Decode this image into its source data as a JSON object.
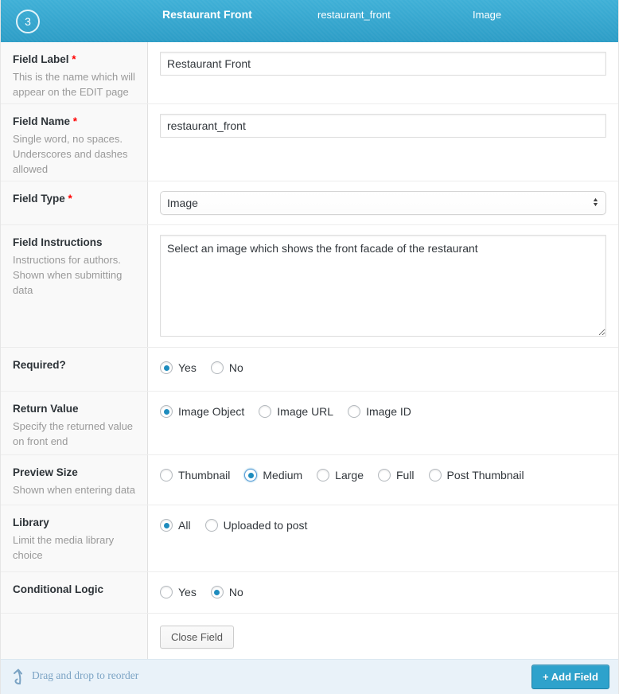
{
  "header": {
    "order_number": "3",
    "field_label": "Restaurant Front",
    "field_name": "restaurant_front",
    "field_type": "Image"
  },
  "misc": {
    "asterisk": "*"
  },
  "icons": {
    "select_stepper_up": "▲",
    "select_stepper_down": "▼"
  },
  "fields": {
    "field_label": {
      "label": "Field Label",
      "description": "This is the name which will appear on the EDIT page",
      "value": "Restaurant Front"
    },
    "field_name": {
      "label": "Field Name",
      "description": "Single word, no spaces. Underscores and dashes allowed",
      "value": "restaurant_front"
    },
    "field_type": {
      "label": "Field Type",
      "value": "Image"
    },
    "field_instructions": {
      "label": "Field Instructions",
      "description": "Instructions for authors. Shown when submitting data",
      "value": "Select an image which shows the front facade of the restaurant"
    },
    "required": {
      "label": "Required?",
      "options": [
        "Yes",
        "No"
      ],
      "selected": "Yes"
    },
    "return_value": {
      "label": "Return Value",
      "description": "Specify the returned value on front end",
      "options": [
        "Image Object",
        "Image URL",
        "Image ID"
      ],
      "selected": "Image Object"
    },
    "preview_size": {
      "label": "Preview Size",
      "description": "Shown when entering data",
      "options": [
        "Thumbnail",
        "Medium",
        "Large",
        "Full",
        "Post Thumbnail"
      ],
      "selected": "Medium"
    },
    "library": {
      "label": "Library",
      "description": "Limit the media library choice",
      "options": [
        "All",
        "Uploaded to post"
      ],
      "selected": "All"
    },
    "conditional_logic": {
      "label": "Conditional Logic",
      "options": [
        "Yes",
        "No"
      ],
      "selected": "No"
    }
  },
  "buttons": {
    "close_field": "Close Field",
    "add_field": "+ Add Field"
  },
  "footer": {
    "reorder_hint": "Drag and drop to reorder"
  },
  "colors": {
    "accent": "#2ea2cc",
    "header_gradient_top": "#3fb0d7",
    "header_gradient_bottom": "#2d9dc6",
    "radio_dot": "#1e8cbe",
    "required_asterisk": "#ff0000",
    "footer_bg": "#e9f2f9",
    "footer_text": "#7ba3c4"
  }
}
